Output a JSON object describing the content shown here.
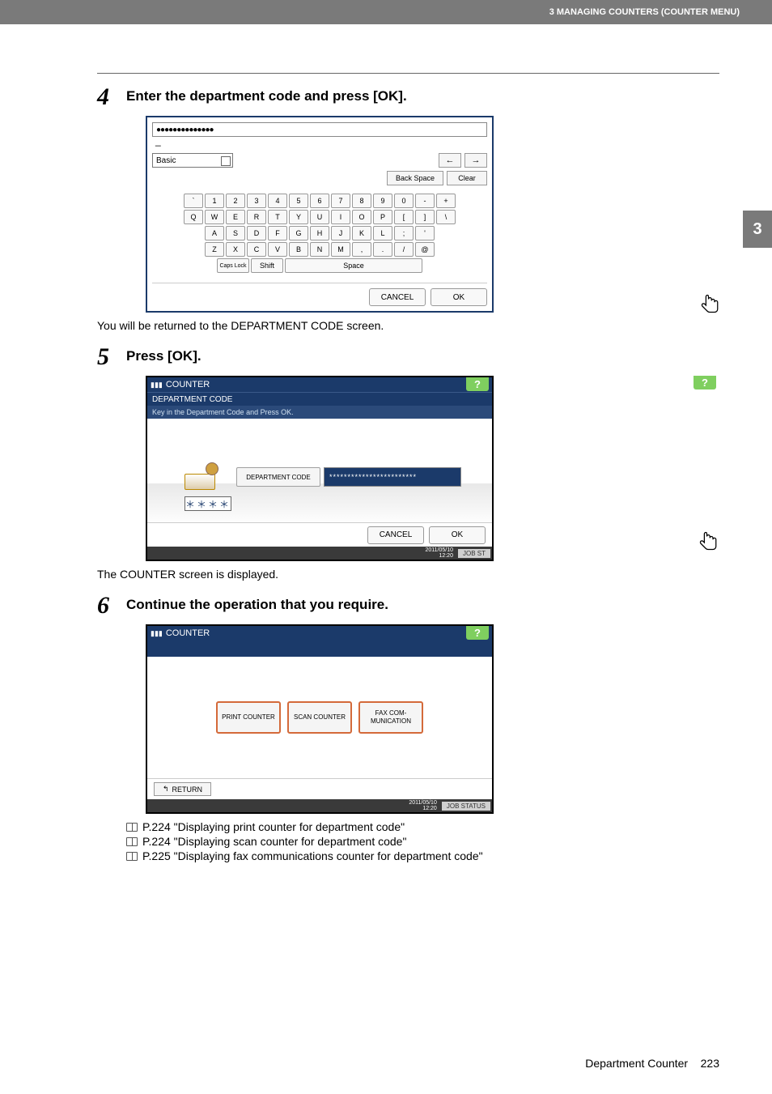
{
  "header": {
    "section_title": "3 MANAGING COUNTERS (COUNTER MENU)"
  },
  "side_tab": {
    "chapter": "3"
  },
  "step4": {
    "num": "4",
    "title": "Enter the department code and press [OK].",
    "after": "You will be returned to the DEPARTMENT CODE screen."
  },
  "step5": {
    "num": "5",
    "title": "Press [OK].",
    "after": "The COUNTER screen is displayed."
  },
  "step6": {
    "num": "6",
    "title": "Continue the operation that you require.",
    "ref1": "P.224 \"Displaying print counter for department code\"",
    "ref2": "P.224 \"Displaying scan counter for department code\"",
    "ref3": "P.225 \"Displaying fax communications counter for department code\""
  },
  "kbd": {
    "display_mask": "●●●●●●●●●●●●●●",
    "mode": "Basic",
    "back_space": "Back Space",
    "clear": "Clear",
    "row_num": [
      "`",
      "1",
      "2",
      "3",
      "4",
      "5",
      "6",
      "7",
      "8",
      "9",
      "0",
      "-",
      "+"
    ],
    "row_q": [
      "Q",
      "W",
      "E",
      "R",
      "T",
      "Y",
      "U",
      "I",
      "O",
      "P",
      "[",
      "]",
      "\\"
    ],
    "row_a": [
      "A",
      "S",
      "D",
      "F",
      "G",
      "H",
      "J",
      "K",
      "L",
      ";",
      "'"
    ],
    "row_z": [
      "Z",
      "X",
      "C",
      "V",
      "B",
      "N",
      "M",
      ",",
      ".",
      "/",
      "@"
    ],
    "caps": "Caps Lock",
    "shift": "Shift",
    "space": "Space",
    "cancel": "CANCEL",
    "ok": "OK"
  },
  "dept": {
    "bar1": "COUNTER",
    "bar2": "DEPARTMENT CODE",
    "hint": "Key in the Department Code and Press OK.",
    "btn": "DEPARTMENT CODE",
    "field_mask": "************************",
    "stars": "＊＊＊＊",
    "cancel": "CANCEL",
    "ok": "OK",
    "date": "2011/05/10",
    "time": "12:20",
    "job": "JOB ST"
  },
  "counter": {
    "bar": "COUNTER",
    "print": "PRINT COUNTER",
    "scan": "SCAN COUNTER",
    "fax": "FAX COM-\nMUNICATION",
    "return": "RETURN",
    "date": "2011/05/10",
    "time": "12:20",
    "job": "JOB STATUS"
  },
  "footer": {
    "section": "Department Counter",
    "page": "223"
  }
}
